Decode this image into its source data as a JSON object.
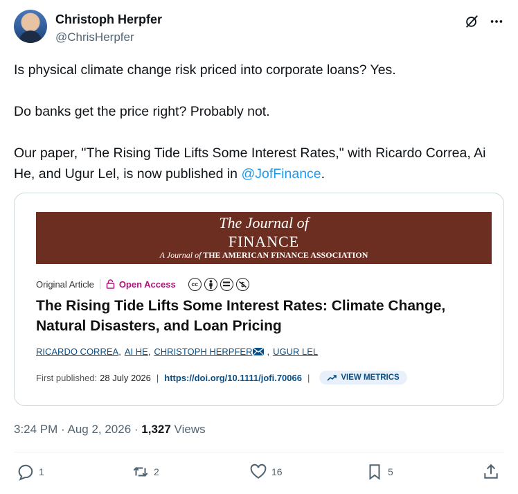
{
  "author": {
    "name": "Christoph Herpfer",
    "handle": "@ChrisHerpfer"
  },
  "header_icons": [
    "grok-icon",
    "more-icon"
  ],
  "tweet": {
    "line1": "Is physical climate change risk priced into corporate loans? Yes.",
    "line2": "Do banks get the price right? Probably not.",
    "line3_prefix": "Our paper, \"The Rising Tide Lifts Some Interest Rates,\" with Ricardo Correa, Ai He, and Ugur Lel, is now published in ",
    "mention": "@JofFinance",
    "line3_suffix": "."
  },
  "card": {
    "banner": {
      "line1": "The Journal of",
      "line2": "FINANCE",
      "line3_italic": "A Journal of",
      "line3_rest": " THE AMERICAN FINANCE ASSOCIATION"
    },
    "article_type": "Original Article",
    "open_access": "Open Access",
    "license_icons": [
      "cc",
      "by",
      "nd",
      "nc"
    ],
    "title": "The Rising Tide Lifts Some Interest Rates: Climate Change, Natural Disasters, and Loan Pricing",
    "authors": [
      "RICARDO CORREA",
      "AI HE",
      "CHRISTOPH HERPFER",
      "UGUR LEL"
    ],
    "first_published_label": "First published:",
    "first_published_date": "28 July 2026",
    "doi": "https://doi.org/10.1111/jofi.70066",
    "metrics_label": "VIEW METRICS"
  },
  "timestamp": {
    "time": "3:24 PM · Aug 2, 2026 · ",
    "views_count": "1,327",
    "views_label": " Views"
  },
  "actions": {
    "replies": "1",
    "reposts": "2",
    "likes": "16",
    "bookmarks": "5"
  },
  "colors": {
    "banner_bg": "#6b2e20",
    "mention": "#1d9bf0",
    "open_access": "#b3147a",
    "link": "#0a4f85"
  }
}
